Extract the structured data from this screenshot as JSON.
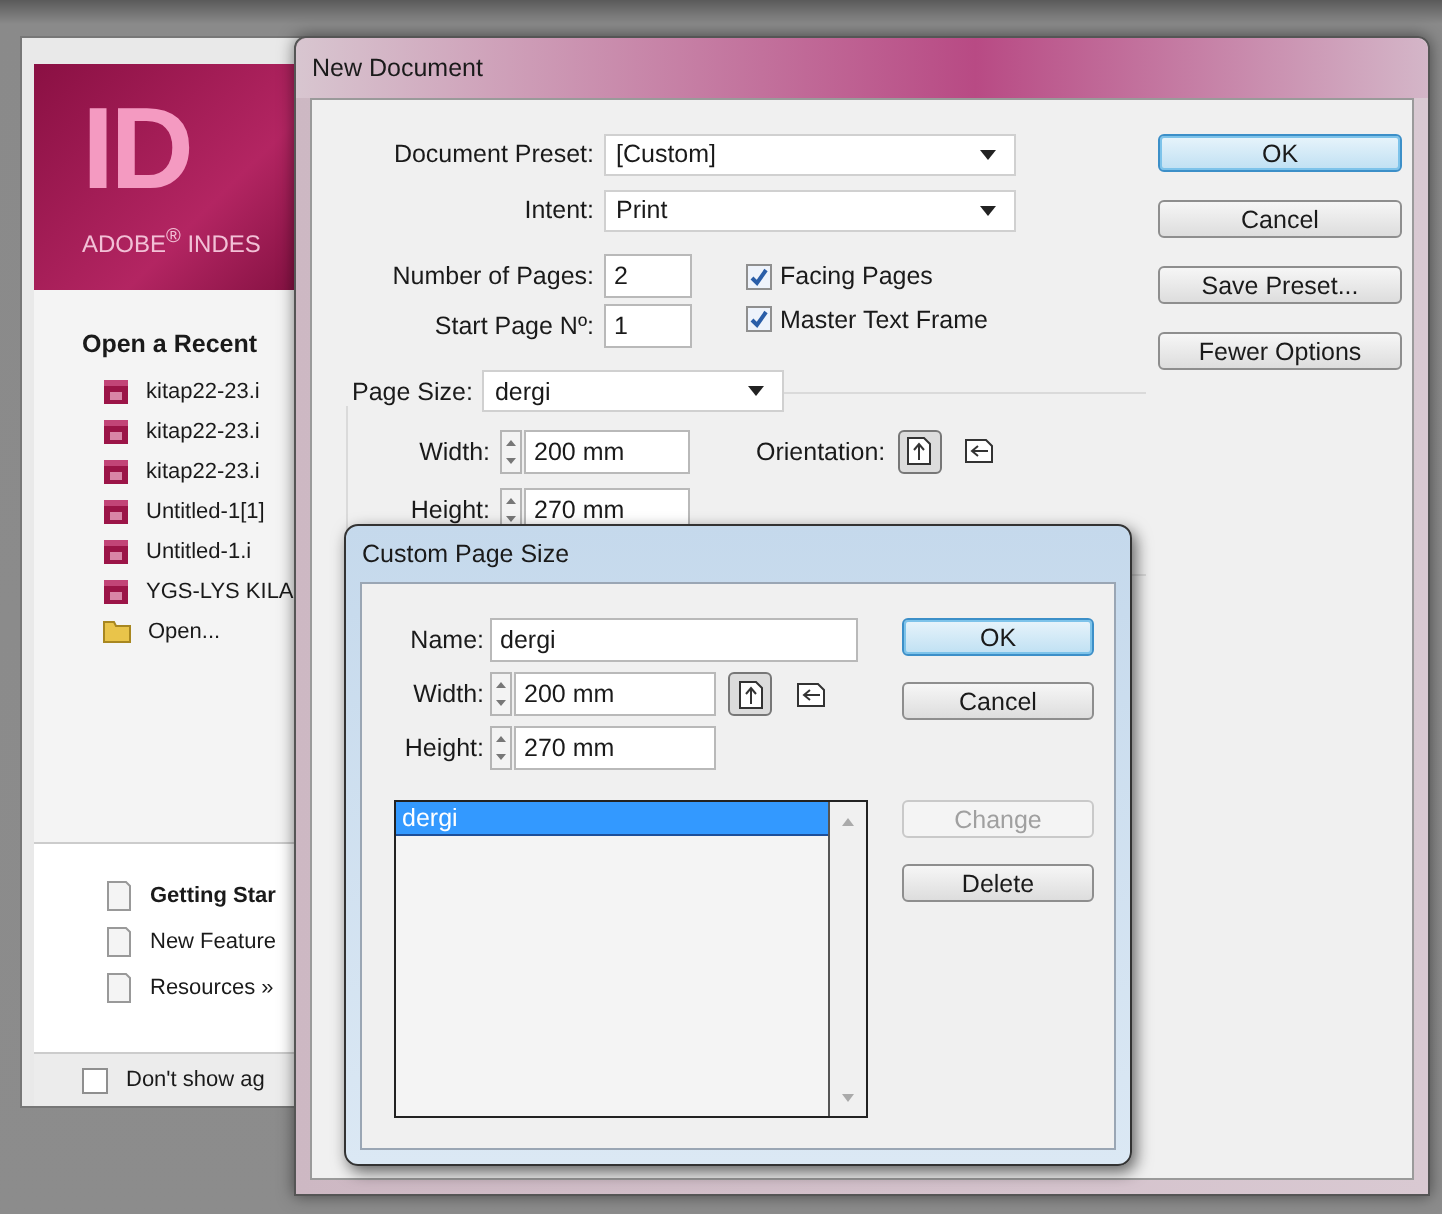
{
  "welcome": {
    "logo": "ID",
    "brand": "ADOBE$^{®}$ INDES",
    "recent_heading": "Open a Recent",
    "recent_items": [
      {
        "kind": "file",
        "label": "kitap22-23.i"
      },
      {
        "kind": "file",
        "label": "kitap22-23.i"
      },
      {
        "kind": "file",
        "label": "kitap22-23.i"
      },
      {
        "kind": "file",
        "label": "Untitled-1[1]"
      },
      {
        "kind": "file",
        "label": "Untitled-1.i"
      },
      {
        "kind": "file",
        "label": "YGS-LYS KILA"
      },
      {
        "kind": "folder",
        "label": "Open..."
      }
    ],
    "links": [
      {
        "label": "Getting Star",
        "bold": true
      },
      {
        "label": "New Feature",
        "bold": false
      },
      {
        "label": "Resources »",
        "bold": false
      }
    ],
    "dont_show": {
      "label": "Don't show ag",
      "checked": false
    }
  },
  "new_document": {
    "title": "New Document",
    "document_preset": {
      "label": "Document Preset:",
      "value": "[Custom]"
    },
    "intent": {
      "label": "Intent:",
      "value": "Print"
    },
    "number_of_pages": {
      "label": "Number of Pages:",
      "value": "2"
    },
    "start_page": {
      "label": "Start Page Nº:",
      "value": "1"
    },
    "checkboxes": [
      {
        "label": "Facing Pages",
        "checked": true
      },
      {
        "label": "Master Text Frame",
        "checked": true
      }
    ],
    "page_size": {
      "label": "Page Size:",
      "value": "dergi"
    },
    "width": {
      "label": "Width:",
      "value": "200 mm"
    },
    "height": {
      "label": "Height:",
      "value": "270 mm"
    },
    "orientation": {
      "label": "Orientation:",
      "options": [
        {
          "kind": "portrait",
          "selected": true
        },
        {
          "kind": "landscape",
          "selected": false
        }
      ]
    },
    "buttons": [
      {
        "label": "OK",
        "default": true,
        "disabled": false
      },
      {
        "label": "Cancel",
        "default": false,
        "disabled": false
      },
      {
        "label": "Save Preset...",
        "default": false,
        "disabled": false
      },
      {
        "label": "Fewer Options",
        "default": false,
        "disabled": false
      }
    ]
  },
  "custom_page_size": {
    "title": "Custom Page Size",
    "name": {
      "label": "Name:",
      "value": "dergi"
    },
    "width": {
      "label": "Width:",
      "value": "200 mm"
    },
    "height": {
      "label": "Height:",
      "value": "270 mm"
    },
    "orientation": [
      {
        "kind": "portrait",
        "selected": true
      },
      {
        "kind": "landscape",
        "selected": false
      }
    ],
    "list": [
      {
        "label": "dergi",
        "selected": true
      }
    ],
    "buttons": [
      {
        "label": "OK",
        "default": true,
        "disabled": false
      },
      {
        "label": "Cancel",
        "default": false,
        "disabled": false
      },
      {
        "label": "Change",
        "default": false,
        "disabled": true
      },
      {
        "label": "Delete",
        "default": false,
        "disabled": false
      }
    ]
  }
}
